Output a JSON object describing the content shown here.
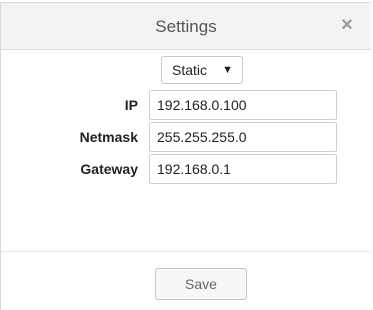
{
  "window": {
    "title": "Settings",
    "close_glyph": "×"
  },
  "mode": {
    "selected": "Static",
    "caret_glyph": "▼"
  },
  "fields": [
    {
      "label": "IP",
      "value": "192.168.0.100"
    },
    {
      "label": "Netmask",
      "value": "255.255.255.0"
    },
    {
      "label": "Gateway",
      "value": "192.168.0.1"
    }
  ],
  "footer": {
    "save_label": "Save"
  }
}
